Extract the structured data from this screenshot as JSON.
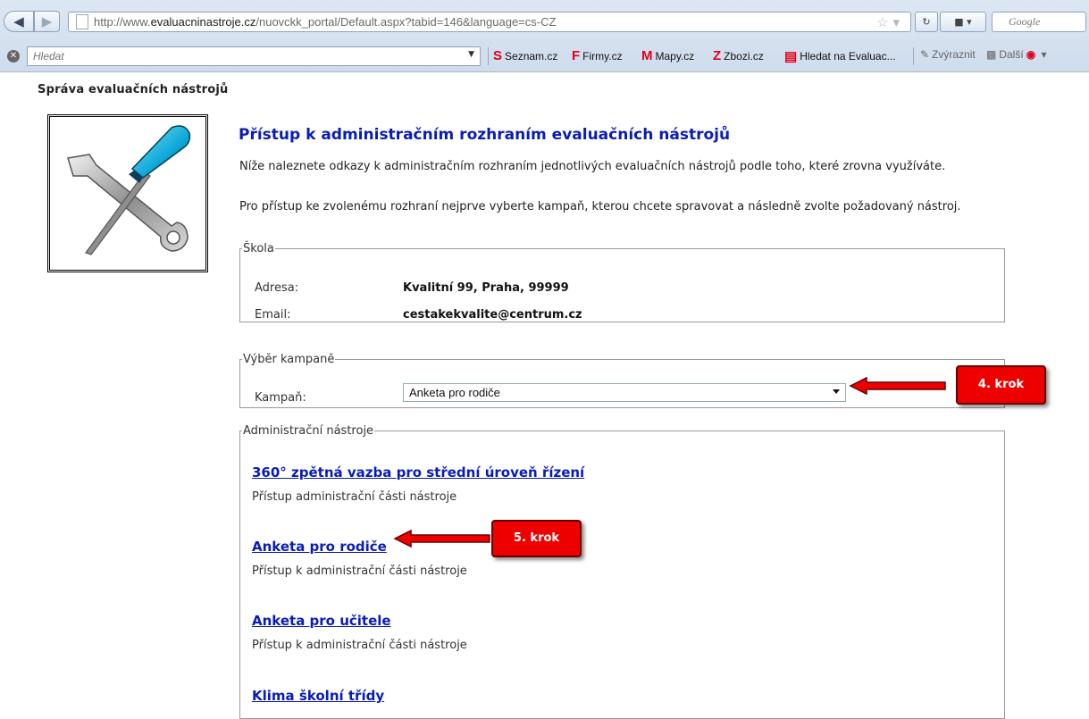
{
  "browser": {
    "url_prefix": "http://www.",
    "url_domain": "evaluacninastroje.cz",
    "url_rest": "/nuovckk_portal/Default.aspx?tabid=146&language=cs-CZ",
    "search_placeholder": "Google",
    "toolbar_search_placeholder": "Hledat",
    "bookmarks": [
      {
        "label": "Seznam.cz",
        "icon": "seznam-icon",
        "color": "#e3001b"
      },
      {
        "label": "Firmy.cz",
        "icon": "firmy-icon",
        "color": "#e3001b"
      },
      {
        "label": "Mapy.cz",
        "icon": "mapy-icon",
        "color": "#e3001b"
      },
      {
        "label": "Zbozi.cz",
        "icon": "zbozi-icon",
        "color": "#e3001b"
      },
      {
        "label": "Hledat na Evaluac...",
        "icon": "document-icon",
        "color": "#e3001b"
      }
    ],
    "highlight_label": "Zvýraznit",
    "more_label": "Další"
  },
  "page": {
    "heading": "Správa evaluačních nástrojů",
    "title": "Přístup k administračním rozhraním evaluačních nástrojů",
    "intro": "Níže naleznete odkazy k administračním rozhraním jednotlivých evaluačních nástrojů podle toho, které zrovna využíváte.",
    "instructions": "Pro přístup ke zvolenému rozhraní nejprve vyberte kampaň, kterou chcete spravovat a následně zvolte požadovaný nástroj."
  },
  "school": {
    "legend": "Škola",
    "address_label": "Adresa:",
    "address_value": "Kvalitní 99, Praha, 99999",
    "email_label": "Email:",
    "email_value": "cestakekvalite@centrum.cz"
  },
  "campaign": {
    "legend": "Výběr kampaně",
    "label": "Kampaň:",
    "selected": "Anketa pro rodiče"
  },
  "tools": {
    "legend": "Administrační nástroje",
    "items": [
      {
        "name": "360° zpětná vazba pro střední úroveň řízení",
        "desc": "Přístup administrační části nástroje"
      },
      {
        "name": "Anketa pro rodiče",
        "desc": "Přístup k administrační části nástroje"
      },
      {
        "name": "Anketa pro učitele",
        "desc": "Přístup k administrační části nástroje"
      },
      {
        "name": "Klima školní třídy",
        "desc": ""
      }
    ]
  },
  "annotations": {
    "step4": "4. krok",
    "step5": "5. krok",
    "color": "#ee0000"
  }
}
